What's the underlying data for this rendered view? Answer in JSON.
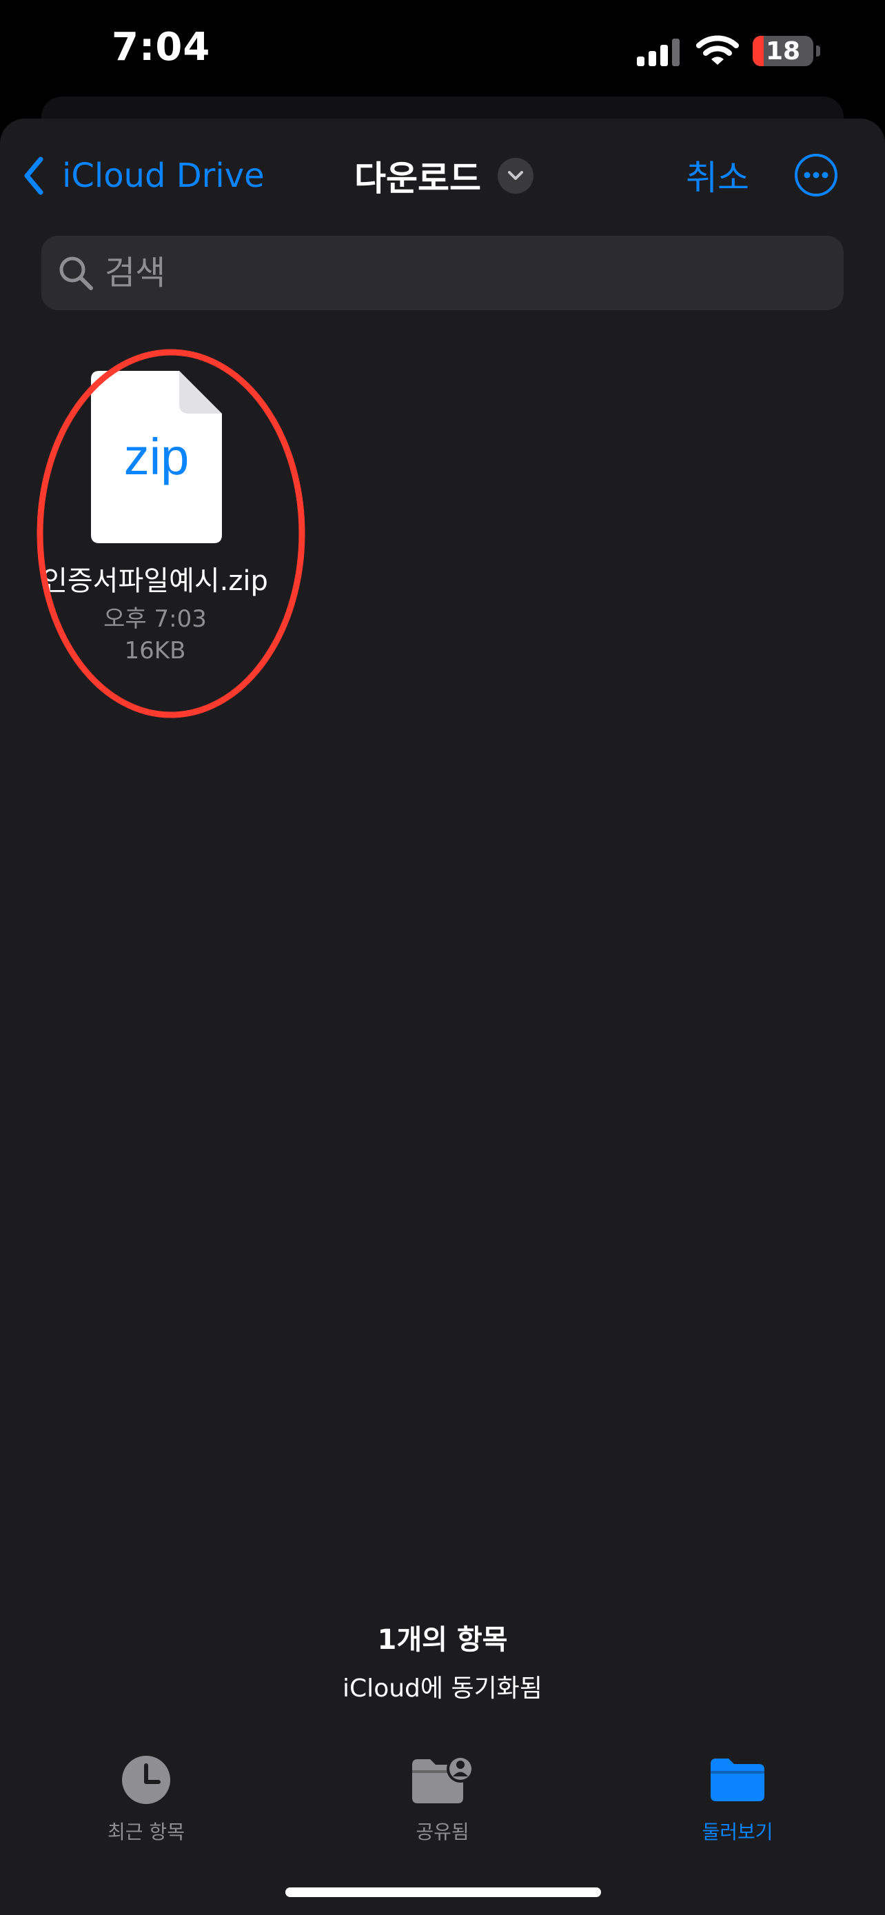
{
  "status_bar": {
    "time": "7:04",
    "battery": "18",
    "battery_level": 0.18,
    "icons": [
      "signal-icon",
      "wifi-icon",
      "battery-icon"
    ]
  },
  "nav": {
    "back_label": "iCloud Drive",
    "title": "다운로드",
    "cancel_label": "취소",
    "icons": [
      "chevron-left-icon",
      "chevron-down-icon",
      "more-icon"
    ]
  },
  "search": {
    "placeholder": "검색",
    "value": ""
  },
  "files": [
    {
      "extension": "zip",
      "name": "인증서파일예시.zip",
      "time": "오후 7:03",
      "size": "16KB"
    }
  ],
  "footer": {
    "item_count": "1개의 항목",
    "sync_status": "iCloud에 동기화됨"
  },
  "tab_bar": {
    "items": [
      {
        "label": "최근 항목",
        "icon": "clock-icon",
        "active": false
      },
      {
        "label": "공유됨",
        "icon": "shared-folder-icon",
        "active": false
      },
      {
        "label": "둘러보기",
        "icon": "folder-icon",
        "active": true
      }
    ]
  },
  "colors": {
    "accent": "#0a84ff",
    "background": "#1c1c1e",
    "secondary_text": "#8e8e93",
    "inactive_tab": "#8e8e93",
    "annotation": "#ff3b30"
  }
}
